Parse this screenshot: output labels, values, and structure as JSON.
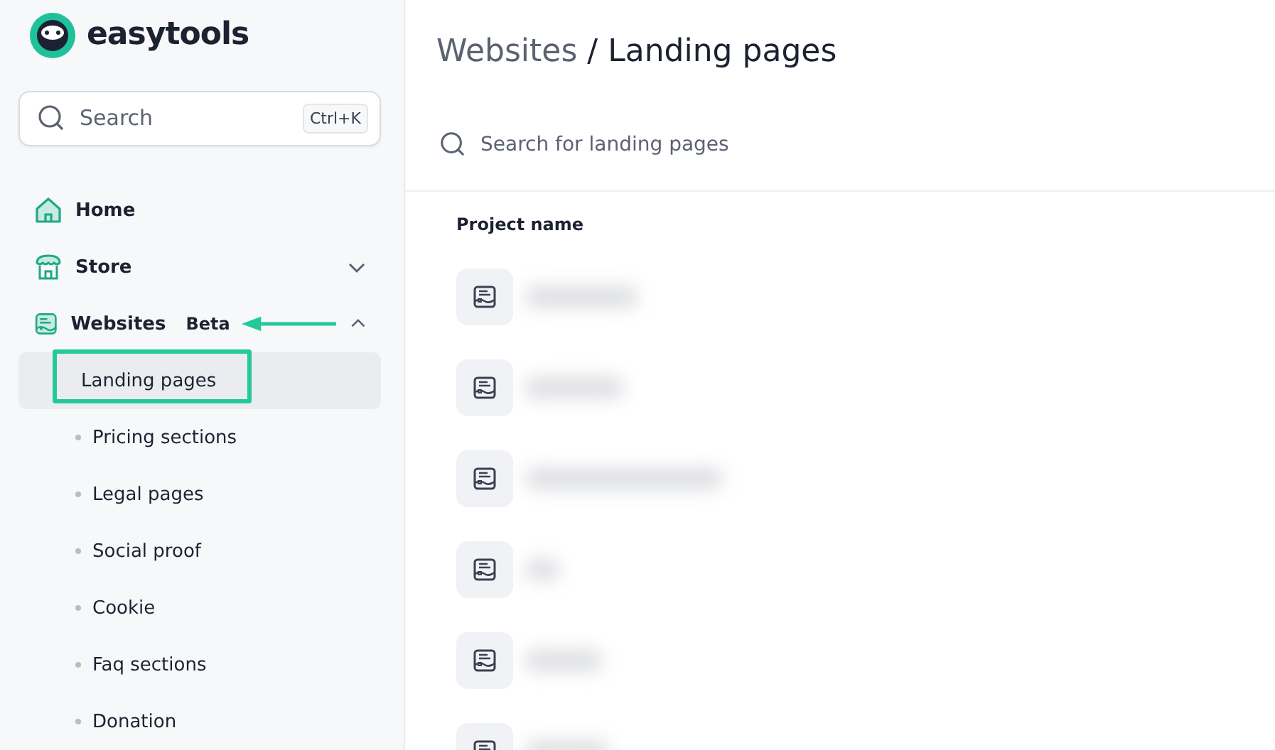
{
  "brand": {
    "name": "easytools"
  },
  "search": {
    "placeholder": "Search",
    "shortcut": "Ctrl+K"
  },
  "nav": [
    {
      "label": "Home",
      "kind": "home"
    },
    {
      "label": "Store",
      "kind": "store",
      "expanded": false
    },
    {
      "label": "Websites",
      "kind": "websites",
      "badge": "Beta",
      "badge_pointed": true,
      "expanded": true,
      "children": [
        {
          "label": "Landing pages",
          "selected": true,
          "highlighted": true
        },
        {
          "label": "Pricing sections",
          "selected": false,
          "highlighted": false
        },
        {
          "label": "Legal pages",
          "selected": false,
          "highlighted": false
        },
        {
          "label": "Social proof",
          "selected": false,
          "highlighted": false
        },
        {
          "label": "Cookie",
          "selected": false,
          "highlighted": false
        },
        {
          "label": "Faq sections",
          "selected": false,
          "highlighted": false
        },
        {
          "label": "Donation",
          "selected": false,
          "highlighted": false
        }
      ]
    }
  ],
  "breadcrumb": {
    "parent": "Websites",
    "separator": "/",
    "current": "Landing pages"
  },
  "page_search": {
    "placeholder": "Search for landing pages"
  },
  "table": {
    "columns": [
      "Project name"
    ],
    "rows": [
      {
        "kind": "blurred"
      },
      {
        "kind": "blurred"
      },
      {
        "kind": "blurred"
      },
      {
        "kind": "blurred"
      },
      {
        "kind": "blurred"
      },
      {
        "kind": "blurred"
      }
    ]
  }
}
